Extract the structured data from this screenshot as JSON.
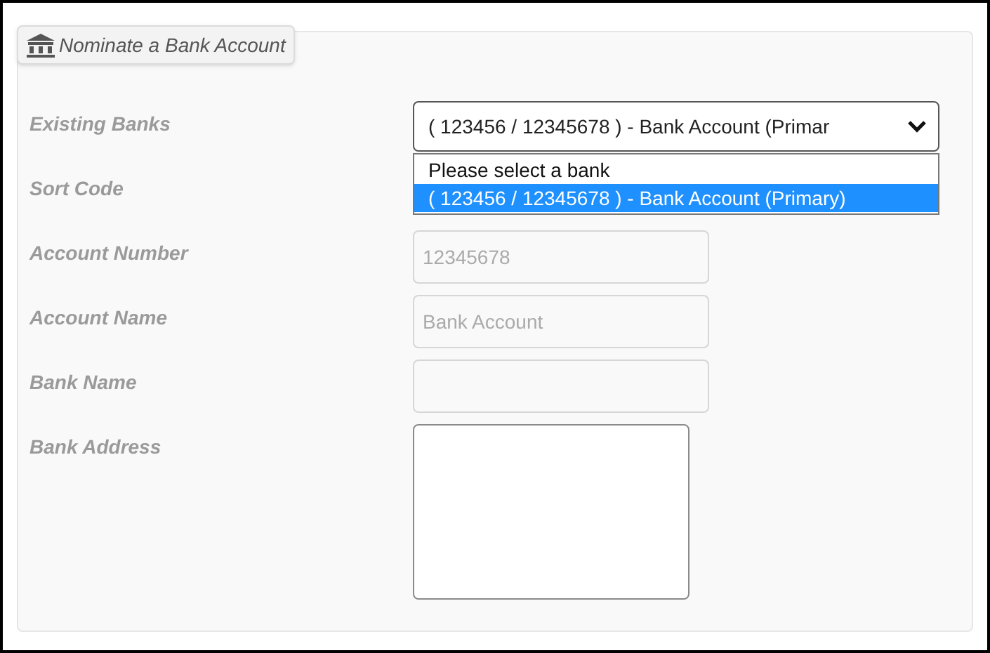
{
  "panel": {
    "title": "Nominate a Bank Account"
  },
  "fields": [
    {
      "label": "Existing Banks",
      "kind": "select",
      "value": "( 123456 / 12345678 ) - Bank Account (Primar",
      "expanded": true,
      "options": [
        {
          "label": "Please select a bank",
          "selected": false
        },
        {
          "label": "( 123456 / 12345678 ) - Bank Account (Primary)",
          "selected": true
        }
      ]
    },
    {
      "label": "Sort Code",
      "kind": "hidden"
    },
    {
      "label": "Account Number",
      "kind": "input",
      "value": "12345678",
      "disabled": true
    },
    {
      "label": "Account Name",
      "kind": "input",
      "value": "Bank Account",
      "disabled": true
    },
    {
      "label": "Bank Name",
      "kind": "input",
      "disabled": true
    },
    {
      "label": "Bank Address",
      "kind": "textarea",
      "disabled": false
    }
  ]
}
